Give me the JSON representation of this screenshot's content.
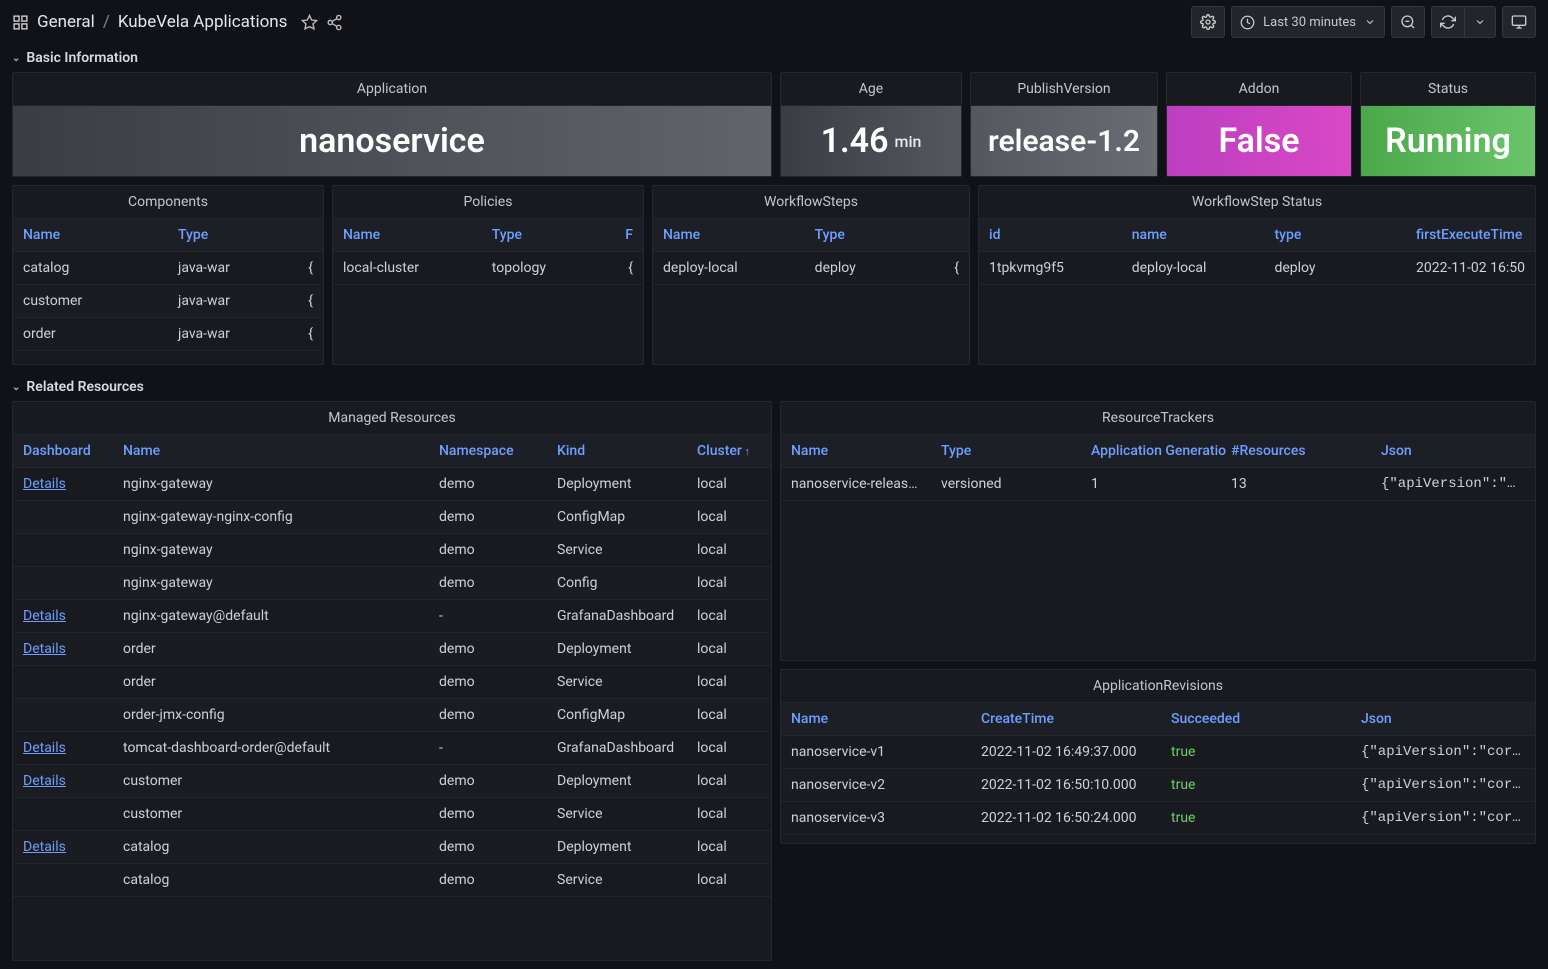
{
  "breadcrumb": {
    "folder": "General",
    "dashboard": "KubeVela Applications"
  },
  "toolbar": {
    "time_range": "Last 30 minutes"
  },
  "sections": {
    "basic": "Basic Information",
    "related": "Related Resources"
  },
  "stats": {
    "application": {
      "title": "Application",
      "value": "nanoservice"
    },
    "age": {
      "title": "Age",
      "value": "1.46",
      "unit": "min"
    },
    "publish": {
      "title": "PublishVersion",
      "value": "release-1.2"
    },
    "addon": {
      "title": "Addon",
      "value": "False"
    },
    "status": {
      "title": "Status",
      "value": "Running"
    }
  },
  "components": {
    "title": "Components",
    "headers": [
      "Name",
      "Type"
    ],
    "rows": [
      {
        "name": "catalog",
        "type": "java-war"
      },
      {
        "name": "customer",
        "type": "java-war"
      },
      {
        "name": "order",
        "type": "java-war"
      }
    ]
  },
  "policies": {
    "title": "Policies",
    "headers": [
      "Name",
      "Type"
    ],
    "rows": [
      {
        "name": "local-cluster",
        "type": "topology"
      }
    ]
  },
  "workflowsteps": {
    "title": "WorkflowSteps",
    "headers": [
      "Name",
      "Type"
    ],
    "rows": [
      {
        "name": "deploy-local",
        "type": "deploy"
      }
    ]
  },
  "workflowstep_status": {
    "title": "WorkflowStep Status",
    "headers": [
      "id",
      "name",
      "type",
      "firstExecuteTime"
    ],
    "rows": [
      {
        "id": "1tpkvmg9f5",
        "name": "deploy-local",
        "type": "deploy",
        "firstExecuteTime": "2022-11-02 16:50"
      }
    ]
  },
  "managed_resources": {
    "title": "Managed Resources",
    "headers": [
      "Dashboard",
      "Name",
      "Namespace",
      "Kind",
      "Cluster"
    ],
    "rows": [
      {
        "dashboard": "Details",
        "name": "nginx-gateway",
        "namespace": "demo",
        "kind": "Deployment",
        "cluster": "local"
      },
      {
        "dashboard": "",
        "name": "nginx-gateway-nginx-config",
        "namespace": "demo",
        "kind": "ConfigMap",
        "cluster": "local"
      },
      {
        "dashboard": "",
        "name": "nginx-gateway",
        "namespace": "demo",
        "kind": "Service",
        "cluster": "local"
      },
      {
        "dashboard": "",
        "name": "nginx-gateway",
        "namespace": "demo",
        "kind": "Config",
        "cluster": "local"
      },
      {
        "dashboard": "Details",
        "name": "nginx-gateway@default",
        "namespace": "-",
        "kind": "GrafanaDashboard",
        "cluster": "local"
      },
      {
        "dashboard": "Details",
        "name": "order",
        "namespace": "demo",
        "kind": "Deployment",
        "cluster": "local"
      },
      {
        "dashboard": "",
        "name": "order",
        "namespace": "demo",
        "kind": "Service",
        "cluster": "local"
      },
      {
        "dashboard": "",
        "name": "order-jmx-config",
        "namespace": "demo",
        "kind": "ConfigMap",
        "cluster": "local"
      },
      {
        "dashboard": "Details",
        "name": "tomcat-dashboard-order@default",
        "namespace": "-",
        "kind": "GrafanaDashboard",
        "cluster": "local"
      },
      {
        "dashboard": "Details",
        "name": "customer",
        "namespace": "demo",
        "kind": "Deployment",
        "cluster": "local"
      },
      {
        "dashboard": "",
        "name": "customer",
        "namespace": "demo",
        "kind": "Service",
        "cluster": "local"
      },
      {
        "dashboard": "Details",
        "name": "catalog",
        "namespace": "demo",
        "kind": "Deployment",
        "cluster": "local"
      },
      {
        "dashboard": "",
        "name": "catalog",
        "namespace": "demo",
        "kind": "Service",
        "cluster": "local"
      }
    ]
  },
  "resource_trackers": {
    "title": "ResourceTrackers",
    "headers": [
      "Name",
      "Type",
      "Application Generatio",
      "#Resources",
      "Json"
    ],
    "rows": [
      {
        "name": "nanoservice-release…",
        "type": "versioned",
        "gen": "1",
        "resources": "13",
        "json": "{\"apiVersion\":\"…"
      }
    ]
  },
  "app_revisions": {
    "title": "ApplicationRevisions",
    "headers": [
      "Name",
      "CreateTime",
      "Succeeded",
      "Json"
    ],
    "rows": [
      {
        "name": "nanoservice-v1",
        "createtime": "2022-11-02 16:49:37.000",
        "succeeded": "true",
        "json": "{\"apiVersion\":\"core…"
      },
      {
        "name": "nanoservice-v2",
        "createtime": "2022-11-02 16:50:10.000",
        "succeeded": "true",
        "json": "{\"apiVersion\":\"core…"
      },
      {
        "name": "nanoservice-v3",
        "createtime": "2022-11-02 16:50:24.000",
        "succeeded": "true",
        "json": "{\"apiVersion\":\"core…"
      }
    ]
  }
}
